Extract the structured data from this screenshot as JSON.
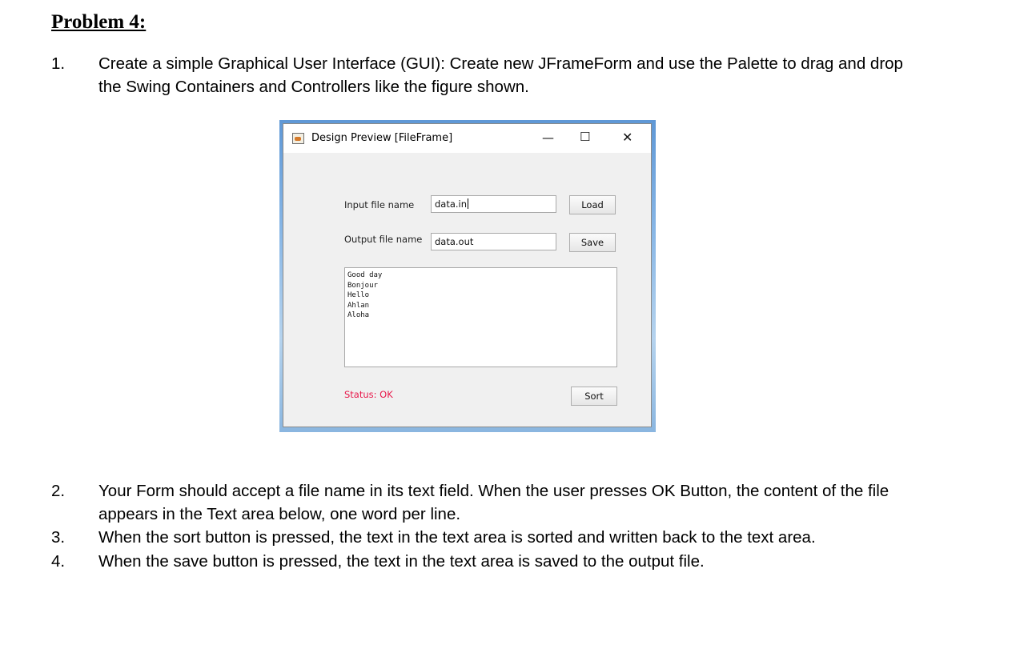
{
  "heading": "Problem 4:",
  "items": [
    {
      "num": "1.",
      "text": "Create a simple Graphical User Interface (GUI): Create new JFrameForm and use the Palette to drag and drop the Swing Containers and Controllers like the figure shown."
    },
    {
      "num": "2.",
      "text": "Your Form should accept a file name in its text field. When the user presses OK Button, the content of the file appears in the Text area below, one word per line."
    },
    {
      "num": "3.",
      "text": "When the sort button is pressed, the text in the text area is sorted and written back to the text area."
    },
    {
      "num": "4.",
      "text": "When the save button is pressed, the text in the text area is saved to the output file."
    }
  ],
  "window": {
    "title": "Design Preview [FileFrame]",
    "minimize_glyph": "—",
    "maximize_glyph": "☐",
    "close_glyph": "✕",
    "input_label": "Input file name",
    "input_value": "data.in",
    "load_label": "Load",
    "output_label": "Output file name",
    "output_value": "data.out",
    "save_label": "Save",
    "textarea_lines": [
      "Good day",
      "Bonjour",
      "Hello",
      "Ahlan",
      "Aloha"
    ],
    "status_text": "Status: OK",
    "status_color": "#e8194b",
    "sort_label": "Sort"
  }
}
